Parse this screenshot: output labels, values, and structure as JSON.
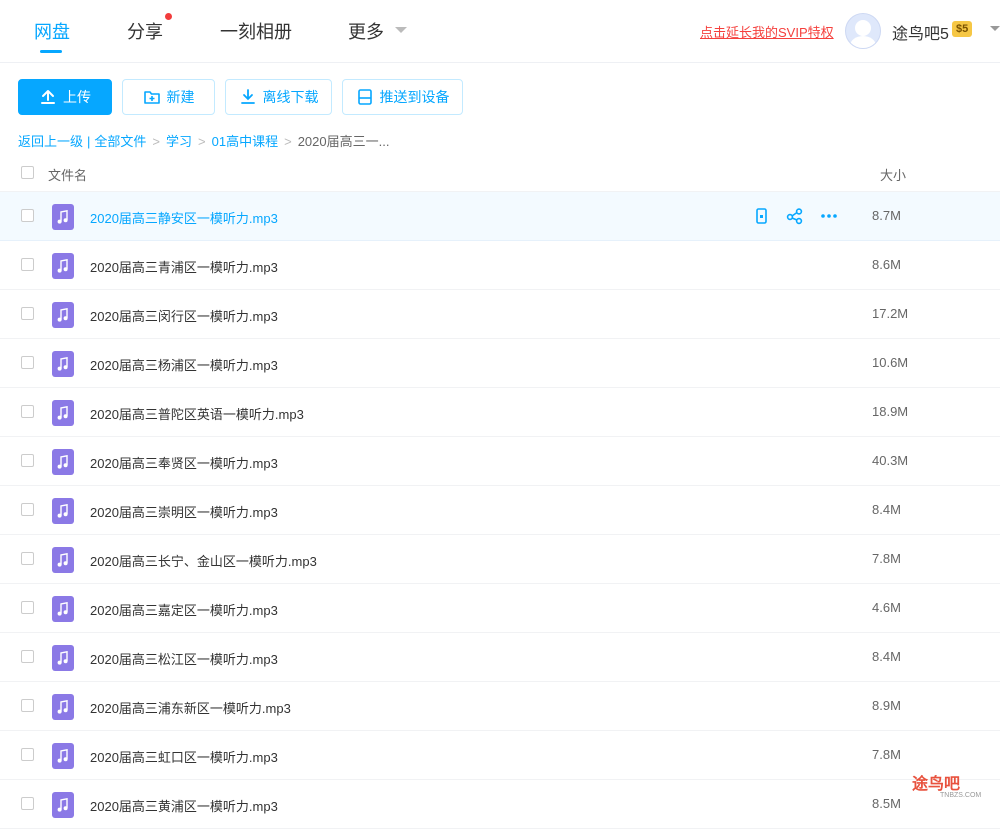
{
  "nav": {
    "tabs": [
      {
        "label": "网盘"
      },
      {
        "label": "分享"
      },
      {
        "label": "一刻相册"
      },
      {
        "label": "更多"
      }
    ],
    "svip_promo": "点击延长我的SVIP特权",
    "username": "途鸟吧5",
    "level": "5"
  },
  "toolbar": {
    "upload": "上传",
    "new": "新建",
    "offline_download": "离线下载",
    "push_to_device": "推送到设备"
  },
  "breadcrumb": {
    "back": "返回上一级",
    "all_files": "全部文件",
    "path": [
      "学习",
      "01高中课程"
    ],
    "current": "2020届高三一..."
  },
  "table": {
    "col_name": "文件名",
    "col_size": "大小"
  },
  "files": [
    {
      "name": "2020届高三静安区一模听力.mp3",
      "size": "8.7M"
    },
    {
      "name": "2020届高三青浦区一模听力.mp3",
      "size": "8.6M"
    },
    {
      "name": "2020届高三闵行区一模听力.mp3",
      "size": "17.2M"
    },
    {
      "name": "2020届高三杨浦区一模听力.mp3",
      "size": "10.6M"
    },
    {
      "name": "2020届高三普陀区英语一模听力.mp3",
      "size": "18.9M"
    },
    {
      "name": "2020届高三奉贤区一模听力.mp3",
      "size": "40.3M"
    },
    {
      "name": "2020届高三崇明区一模听力.mp3",
      "size": "8.4M"
    },
    {
      "name": "2020届高三长宁、金山区一模听力.mp3",
      "size": "7.8M"
    },
    {
      "name": "2020届高三嘉定区一模听力.mp3",
      "size": "4.6M"
    },
    {
      "name": "2020届高三松江区一模听力.mp3",
      "size": "8.4M"
    },
    {
      "name": "2020届高三浦东新区一模听力.mp3",
      "size": "8.9M"
    },
    {
      "name": "2020届高三虹口区一模听力.mp3",
      "size": "7.8M"
    },
    {
      "name": "2020届高三黄浦区一模听力.mp3",
      "size": "8.5M"
    }
  ],
  "watermark": {
    "text": "途鸟吧",
    "sub": "TNBZS.COM"
  },
  "colors": {
    "accent": "#06a7ff",
    "promo": "#f5403d",
    "music_icon": "#8b79e6"
  }
}
